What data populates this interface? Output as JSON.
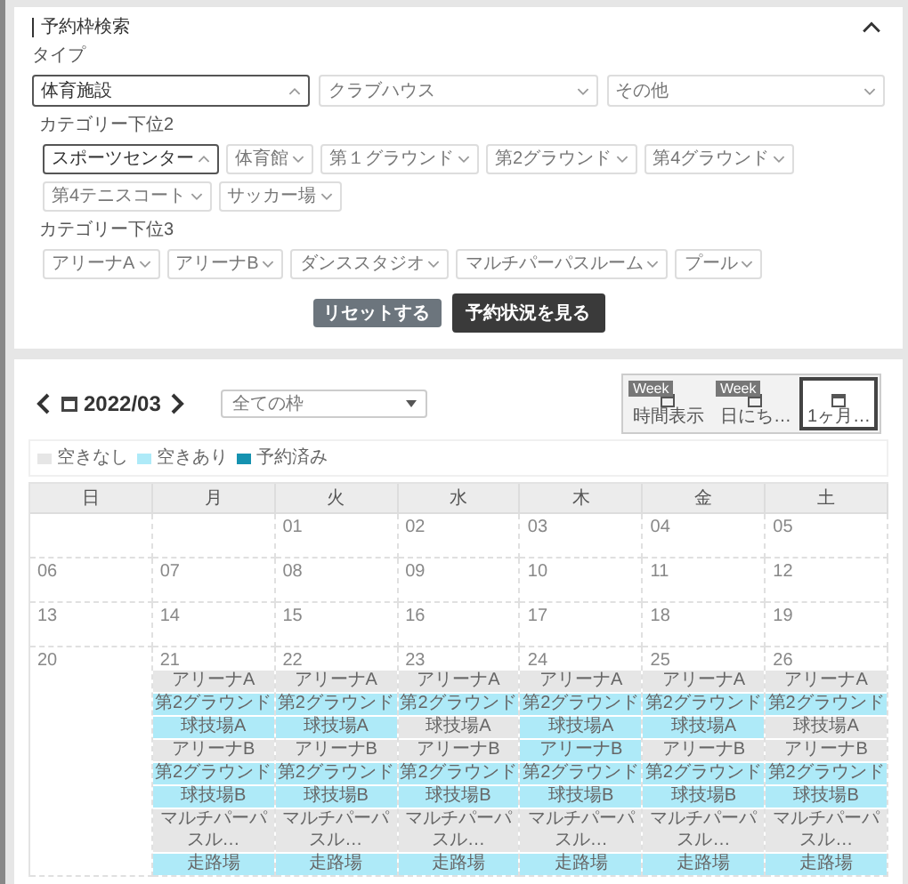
{
  "search_panel": {
    "title": "予約枠検索",
    "expanded": true,
    "type_label": "タイプ",
    "types": [
      {
        "label": "体育施設",
        "expanded": true
      },
      {
        "label": "クラブハウス",
        "expanded": false
      },
      {
        "label": "その他",
        "expanded": false
      }
    ],
    "category2_label": "カテゴリー下位2",
    "category2": [
      {
        "label": "スポーツセンター",
        "expanded": true
      },
      {
        "label": "体育館",
        "expanded": false
      },
      {
        "label": "第１グラウンド",
        "expanded": false
      },
      {
        "label": "第2グラウンド",
        "expanded": false
      },
      {
        "label": "第4グラウンド",
        "expanded": false
      },
      {
        "label": "第4テニスコート",
        "expanded": false
      },
      {
        "label": "サッカー場",
        "expanded": false
      }
    ],
    "category3_label": "カテゴリー下位3",
    "category3": [
      {
        "label": "アリーナA",
        "expanded": false
      },
      {
        "label": "アリーナB",
        "expanded": false
      },
      {
        "label": "ダンススタジオ",
        "expanded": false
      },
      {
        "label": "マルチパーパスルーム",
        "expanded": false
      },
      {
        "label": "プール",
        "expanded": false
      }
    ],
    "buttons": [
      {
        "label": "リセットする",
        "kind": "secondary"
      },
      {
        "label": "予約状況を見る",
        "kind": "primary"
      }
    ]
  },
  "calendar": {
    "month": "2022/03",
    "filter": "全ての枠",
    "views": [
      {
        "badge": "Week",
        "label": "時間表示",
        "selected": false
      },
      {
        "badge": "Week",
        "label": "日にち…",
        "selected": false
      },
      {
        "label": "1ヶ月…",
        "selected": true
      }
    ],
    "legend": [
      {
        "label": "空きなし",
        "color": "#e6e6e6"
      },
      {
        "label": "空きあり",
        "color": "#aeeaf8"
      },
      {
        "label": "予約済み",
        "color": "#1592b0"
      }
    ],
    "weekdays": [
      "日",
      "月",
      "火",
      "水",
      "木",
      "金",
      "土"
    ],
    "weeks": [
      [
        {
          "kind": "blank"
        },
        {
          "kind": "blank"
        },
        {
          "kind": "day",
          "date": "01"
        },
        {
          "kind": "day",
          "date": "02"
        },
        {
          "kind": "day",
          "date": "03"
        },
        {
          "kind": "day",
          "date": "04"
        },
        {
          "kind": "day",
          "date": "05"
        }
      ],
      [
        {
          "kind": "day",
          "date": "06"
        },
        {
          "kind": "day",
          "date": "07"
        },
        {
          "kind": "day",
          "date": "08"
        },
        {
          "kind": "day",
          "date": "09"
        },
        {
          "kind": "day",
          "date": "10"
        },
        {
          "kind": "day",
          "date": "11"
        },
        {
          "kind": "day",
          "date": "12"
        }
      ],
      [
        {
          "kind": "day",
          "date": "13"
        },
        {
          "kind": "day",
          "date": "14"
        },
        {
          "kind": "day",
          "date": "15"
        },
        {
          "kind": "day",
          "date": "16"
        },
        {
          "kind": "day",
          "date": "17"
        },
        {
          "kind": "day",
          "date": "18"
        },
        {
          "kind": "day",
          "date": "19"
        }
      ],
      [
        {
          "kind": "day",
          "date": "20"
        },
        {
          "kind": "day",
          "date": "21",
          "slots": [
            {
              "label": "アリーナA",
              "available": false
            },
            {
              "label": "第2グラウンド",
              "available": true
            },
            {
              "label": "球技場A",
              "available": true
            },
            {
              "label": "アリーナB",
              "available": false
            },
            {
              "label": "第2グラウンド",
              "available": true
            },
            {
              "label": "球技場B",
              "available": true
            },
            {
              "label": "マルチパーパスル…",
              "available": false
            },
            {
              "label": "走路場",
              "available": true
            }
          ]
        },
        {
          "kind": "day",
          "date": "22",
          "slots": [
            {
              "label": "アリーナA",
              "available": false
            },
            {
              "label": "第2グラウンド",
              "available": true
            },
            {
              "label": "球技場A",
              "available": true
            },
            {
              "label": "アリーナB",
              "available": false
            },
            {
              "label": "第2グラウンド",
              "available": true
            },
            {
              "label": "球技場B",
              "available": true
            },
            {
              "label": "マルチパーパスル…",
              "available": false
            },
            {
              "label": "走路場",
              "available": true
            }
          ]
        },
        {
          "kind": "day",
          "date": "23",
          "slots": [
            {
              "label": "アリーナA",
              "available": false
            },
            {
              "label": "第2グラウンド",
              "available": true
            },
            {
              "label": "球技場A",
              "available": false
            },
            {
              "label": "アリーナB",
              "available": false
            },
            {
              "label": "第2グラウンド",
              "available": true
            },
            {
              "label": "球技場B",
              "available": true
            },
            {
              "label": "マルチパーパスル…",
              "available": false
            },
            {
              "label": "走路場",
              "available": true
            }
          ]
        },
        {
          "kind": "day",
          "date": "24",
          "slots": [
            {
              "label": "アリーナA",
              "available": false
            },
            {
              "label": "第2グラウンド",
              "available": true
            },
            {
              "label": "球技場A",
              "available": true
            },
            {
              "label": "アリーナB",
              "available": true
            },
            {
              "label": "第2グラウンド",
              "available": true
            },
            {
              "label": "球技場B",
              "available": true
            },
            {
              "label": "マルチパーパスル…",
              "available": false
            },
            {
              "label": "走路場",
              "available": true
            }
          ]
        },
        {
          "kind": "day",
          "date": "25",
          "slots": [
            {
              "label": "アリーナA",
              "available": false
            },
            {
              "label": "第2グラウンド",
              "available": true
            },
            {
              "label": "球技場A",
              "available": true
            },
            {
              "label": "アリーナB",
              "available": false
            },
            {
              "label": "第2グラウンド",
              "available": true
            },
            {
              "label": "球技場B",
              "available": true
            },
            {
              "label": "マルチパーパスル…",
              "available": false
            },
            {
              "label": "走路場",
              "available": true
            }
          ]
        },
        {
          "kind": "day",
          "date": "26",
          "slots": [
            {
              "label": "アリーナA",
              "available": false
            },
            {
              "label": "第2グラウンド",
              "available": true
            },
            {
              "label": "球技場A",
              "available": false
            },
            {
              "label": "アリーナB",
              "available": false
            },
            {
              "label": "第2グラウンド",
              "available": true
            },
            {
              "label": "球技場B",
              "available": true
            },
            {
              "label": "マルチパーパスル…",
              "available": false
            },
            {
              "label": "走路場",
              "available": true
            }
          ]
        }
      ]
    ]
  }
}
